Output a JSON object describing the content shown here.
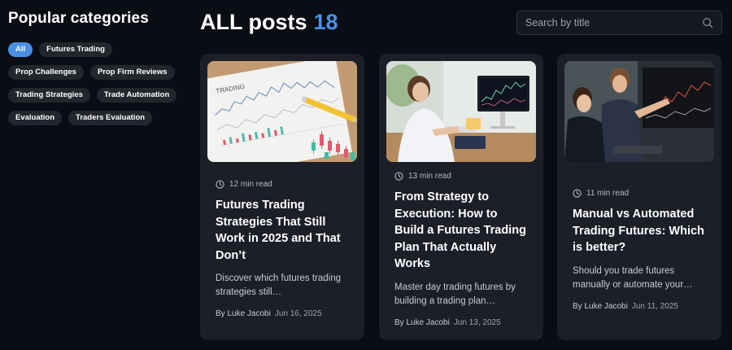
{
  "sidebar": {
    "title": "Popular categories",
    "tags": [
      "All",
      "Futures Trading",
      "Prop Challenges",
      "Prop Firm Reviews",
      "Trading Strategies",
      "Trade Automation",
      "Evaluation",
      "Traders Evaluation"
    ],
    "active_tag": "All"
  },
  "header": {
    "title": "ALL posts",
    "count": "18"
  },
  "search": {
    "placeholder": "Search by title"
  },
  "posts": [
    {
      "read_time": "12 min read",
      "title": "Futures Trading Strategies That Still Work in 2025 and That Don’t",
      "excerpt": "Discover which futures trading strategies still…",
      "author": "By Luke Jacobi",
      "date": "Jun 16, 2025",
      "image_text": "TRADING"
    },
    {
      "read_time": "13 min read",
      "title": "From Strategy to Execution: How to Build a Futures Trading Plan That Actually Works",
      "excerpt": "Master day trading futures by building a trading plan…",
      "author": "By Luke Jacobi",
      "date": "Jun 13, 2025"
    },
    {
      "read_time": "11 min read",
      "title": "Manual vs Automated Trading Futures: Which is better?",
      "excerpt": "Should you trade futures manually or automate your…",
      "author": "By Luke Jacobi",
      "date": "Jun 11, 2025"
    }
  ],
  "colors": {
    "background": "#0b0d14",
    "card": "#1c1f27",
    "accent": "#4a90e2",
    "tag": "#23262d"
  },
  "icons": {
    "search": "search-icon",
    "clock": "clock-icon"
  }
}
